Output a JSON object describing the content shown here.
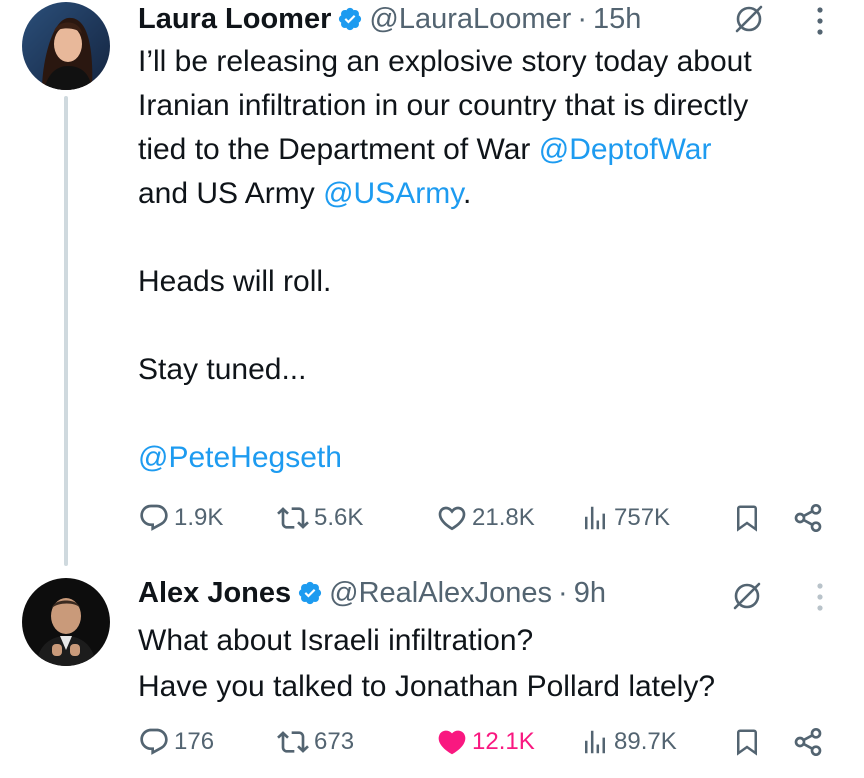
{
  "tweets": [
    {
      "author": {
        "name": "Laura Loomer",
        "handle": "@LauraLoomer",
        "verified": true
      },
      "separator": "·",
      "time": "15h",
      "text_parts": {
        "line1": "I’ll be releasing an explosive story today about\nIranian infiltration in our country that is directly\ntied to the Department of War ",
        "mention1": "@DeptofWar",
        "line2": "\nand US Army ",
        "mention2": "@USArmy",
        "line3": ".\n\nHeads will roll.\n\nStay tuned...\n\n",
        "mention3": "@PeteHegseth"
      },
      "stats": {
        "replies": "1.9K",
        "reposts": "5.6K",
        "likes": "21.8K",
        "views": "757K"
      },
      "liked": false
    },
    {
      "author": {
        "name": "Alex Jones",
        "handle": "@RealAlexJones",
        "verified": true
      },
      "separator": "·",
      "time": "9h",
      "text": "What about Israeli infiltration?\nHave you talked to Jonathan Pollard lately?",
      "stats": {
        "replies": "176",
        "reposts": "673",
        "likes": "12.1K",
        "views": "89.7K"
      },
      "liked": true
    }
  ],
  "icons": {
    "verified": "verified-badge-icon",
    "grok": "grok-icon",
    "more": "more-icon",
    "reply": "reply-icon",
    "repost": "repost-icon",
    "like": "heart-icon",
    "views": "views-icon",
    "bookmark": "bookmark-icon",
    "share": "share-icon"
  },
  "colors": {
    "link": "#1d9bf0",
    "muted": "#536471",
    "text": "#0f1419",
    "like": "#f91880",
    "thread_line": "#cfd9de"
  }
}
